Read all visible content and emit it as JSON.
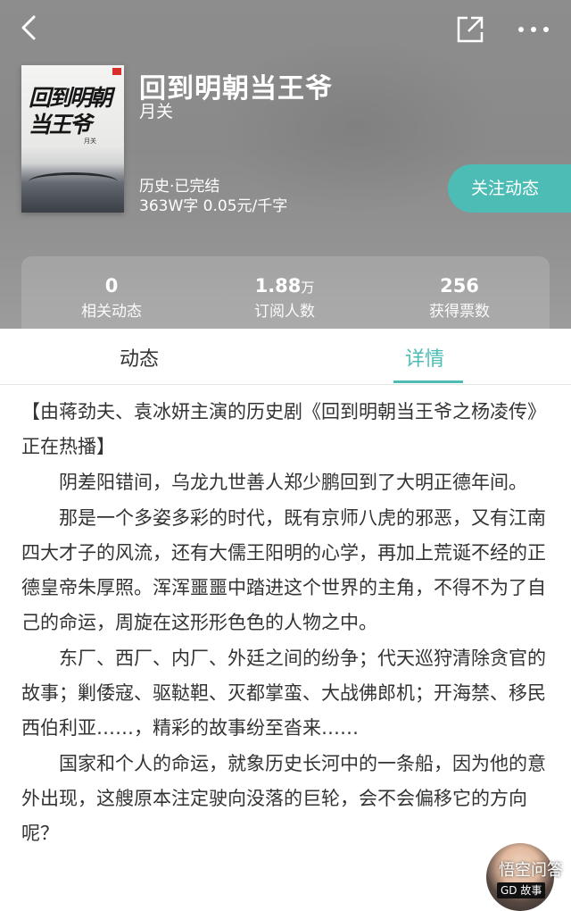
{
  "book": {
    "title": "回到明朝当王爷",
    "author": "月关",
    "genre": "历史·已完结",
    "stats": "363W字  0.05元/千字",
    "follow_label": "关注动态",
    "cover": {
      "title": "回到明朝当王爷",
      "author": "月关"
    }
  },
  "stats": [
    {
      "value": "0",
      "unit": "",
      "label": "相关动态"
    },
    {
      "value": "1.88",
      "unit": "万",
      "label": "订阅人数"
    },
    {
      "value": "256",
      "unit": "",
      "label": "获得票数"
    }
  ],
  "tabs": [
    {
      "label": "动态",
      "active": false
    },
    {
      "label": "详情",
      "active": true
    }
  ],
  "content": [
    "【由蒋劲夫、袁冰妍主演的历史剧《回到明朝当王爷之杨凌传》正在热播】",
    "阴差阳错间，乌龙九世善人郑少鹏回到了大明正德年间。",
    "那是一个多姿多彩的时代，既有京师八虎的邪恶，又有江南四大才子的风流，还有大儒王阳明的心学，再加上荒诞不经的正德皇帝朱厚照。浑浑噩噩中踏进这个世界的主角，不得不为了自己的命运，周旋在这形形色色的人物之中。",
    "东厂、西厂、内厂、外廷之间的纷争；代天巡狩清除贪官的故事；剿倭寇、驱鞑靼、灭都掌蛮、大战佛郎机；开海禁、移民西伯利亚……，精彩的故事纷至沓来……",
    "国家和个人的命运，就象历史长河中的一条船，因为他的意外出现，这艘原本注定驶向没落的巨轮，会不会偏移它的方向呢？"
  ],
  "watermark": {
    "text": "悟空问答",
    "tag": "GD 故事"
  },
  "colors": {
    "accent": "#4cbcb4",
    "header_bg": "#8d8d8d"
  }
}
